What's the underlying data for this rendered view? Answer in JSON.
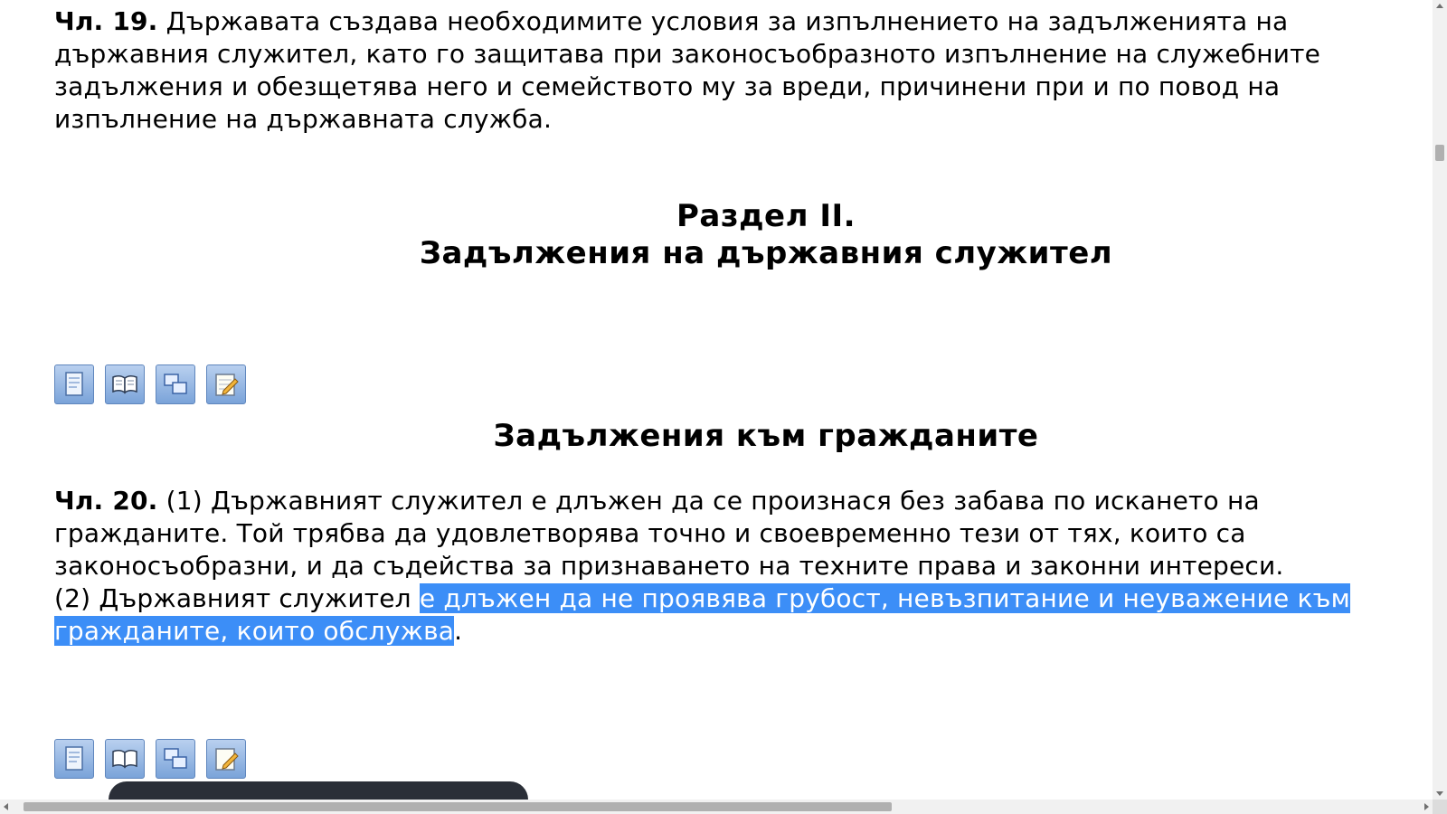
{
  "article19": {
    "label": "Чл. 19.",
    "text": "Държавата създава необходимите условия за изпълнението на задълженията на държавния служител, като го защитава при законосъобразното изпълнение на служебните задължения и обезщетява него и семейството му за вреди, причинени при и по повод на изпълнение на държавната служба."
  },
  "section": {
    "number": "Раздел II.",
    "title": "Задължения на държавния служител"
  },
  "toolbar": {
    "icons": [
      "document-icon",
      "book-icon",
      "compare-icon",
      "edit-note-icon"
    ]
  },
  "subheading": "Задължения към гражданите",
  "article20": {
    "label": "Чл. 20.",
    "p1": "(1) Държавният служител е длъжен да се произнася без забава по искането на гражданите. Той трябва да удовлетворява точно и своевременно тези от тях, които са законосъобразни, и да съдейства за признаването на техните права и законни интереси.",
    "p2_before": "(2) Държавният служител ",
    "p2_selected": "е длъжен да не проявява грубост, невъзпитание и неуважение към гражданите, които обслужва",
    "p2_after": "."
  },
  "colors": {
    "selection": "#3c8ef7",
    "toolbar_button": "#8fb2e0",
    "toast": "#2b2f38"
  }
}
